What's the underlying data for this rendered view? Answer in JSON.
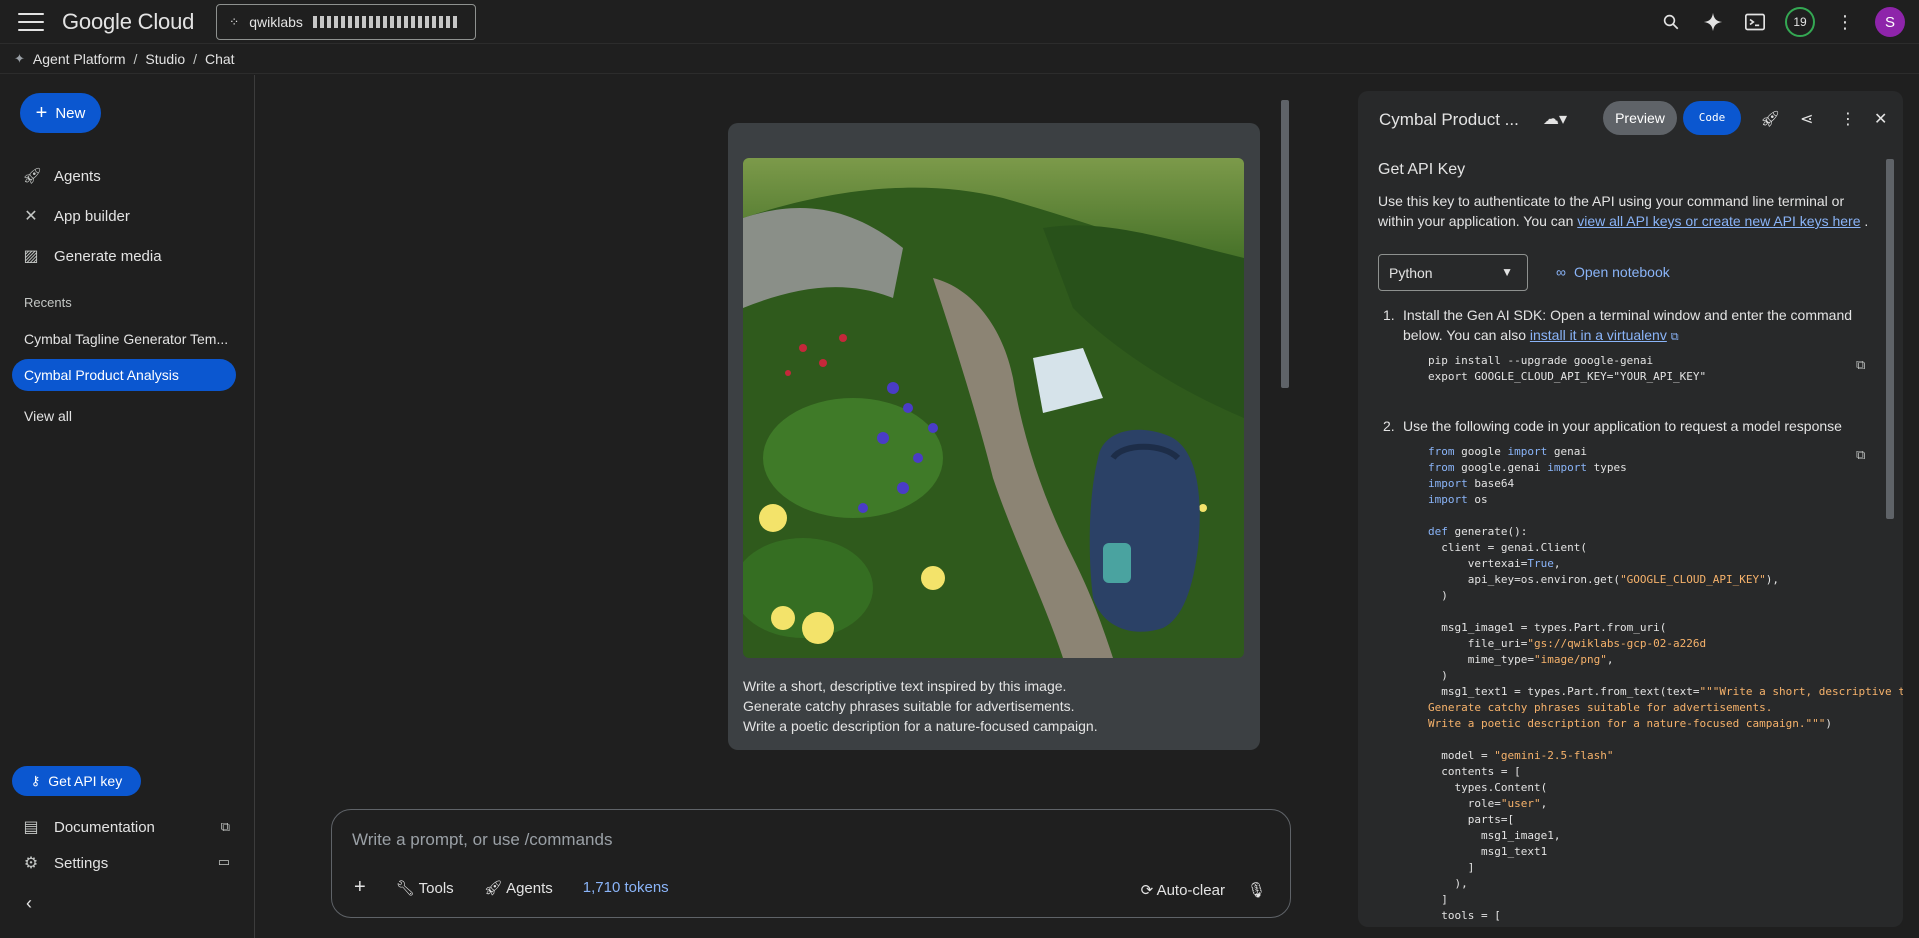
{
  "topbar": {
    "logo": "Google Cloud",
    "project": "qwiklabs",
    "notifications": "19",
    "avatar": "S"
  },
  "breadcrumb": [
    "Agent Platform",
    "Studio",
    "Chat"
  ],
  "sidebar": {
    "new_label": "New",
    "items": [
      {
        "label": "Agents"
      },
      {
        "label": "App builder"
      },
      {
        "label": "Generate media"
      }
    ],
    "recents_label": "Recents",
    "recents": [
      "Cymbal Tagline Generator Tem...",
      "Cymbal Product Analysis"
    ],
    "view_all": "View all",
    "get_api_key": "Get API key",
    "documentation": "Documentation",
    "settings": "Settings"
  },
  "chat": {
    "message_lines": [
      "Write a short, descriptive text inspired by this image.",
      "Generate catchy phrases suitable for advertisements.",
      "Write a poetic description for a nature-focused campaign."
    ],
    "prompt_placeholder": "Write a prompt, or use /commands",
    "tools": "Tools",
    "agents": "Agents",
    "tokens": "1,710 tokens",
    "auto_clear": "Auto-clear"
  },
  "panel": {
    "title": "Cymbal Product ...",
    "preview": "Preview",
    "code": "Code",
    "section_title": "Get API Key",
    "desc_a": "Use this key to authenticate to the API using your command line terminal or within your application. You can",
    "desc_link": "view all API keys or create new API keys here",
    "desc_end": ".",
    "language": "Python",
    "open_notebook": "Open notebook",
    "step1_num": "1.",
    "step1_a": "Install the Gen AI SDK: Open a terminal window and enter the command below. You can also",
    "step1_link": "install it in a virtualenv",
    "step1_code": "pip install --upgrade google-genai\nexport GOOGLE_CLOUD_API_KEY=\"YOUR_API_KEY\"",
    "step2_num": "2.",
    "step2": "Use the following code in your application to request a model response"
  },
  "colors": {
    "accent": "#0b57d0",
    "link": "#8ab4f8",
    "bg": "#1f1f1f"
  }
}
